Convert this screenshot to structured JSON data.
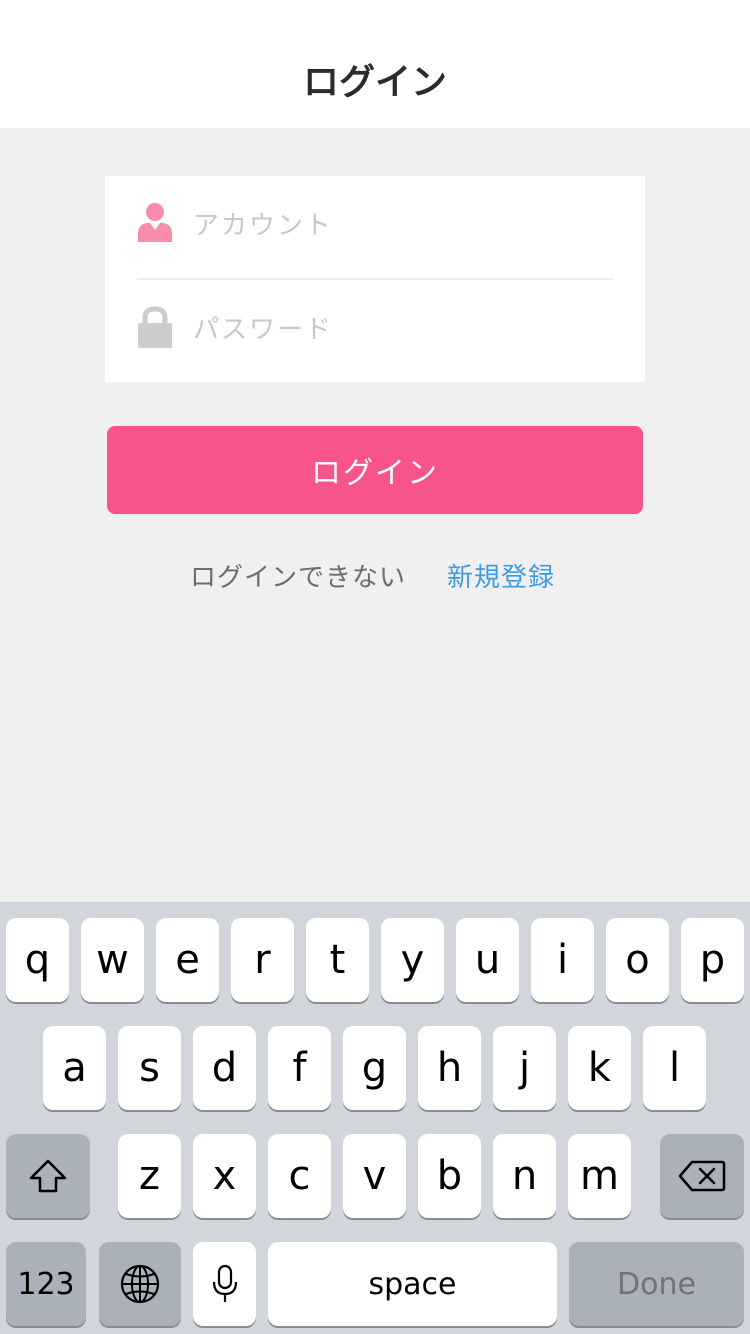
{
  "navbar": {
    "title": "ログイン"
  },
  "form": {
    "account_placeholder": "アカウント",
    "password_placeholder": "パスワード",
    "account_icon": "user-icon",
    "password_icon": "lock-icon"
  },
  "login_button": {
    "label": "ログイン"
  },
  "links": {
    "cant_login": "ログインできない",
    "register": "新規登録"
  },
  "keyboard": {
    "row1": [
      "q",
      "w",
      "e",
      "r",
      "t",
      "y",
      "u",
      "i",
      "o",
      "p"
    ],
    "row2": [
      "a",
      "s",
      "d",
      "f",
      "g",
      "h",
      "j",
      "k",
      "l"
    ],
    "row3": [
      "z",
      "x",
      "c",
      "v",
      "b",
      "n",
      "m"
    ],
    "numbers_label": "123",
    "space_label": "space",
    "done_label": "Done",
    "shift_icon": "shift-icon",
    "delete_icon": "backspace-icon",
    "globe_icon": "globe-icon",
    "mic_icon": "microphone-icon"
  },
  "colors": {
    "accent": "#f7558a",
    "link": "#3d9be0",
    "icon_user": "#f98bad",
    "icon_lock": "#cccccc",
    "background": "#f0f0f0"
  }
}
